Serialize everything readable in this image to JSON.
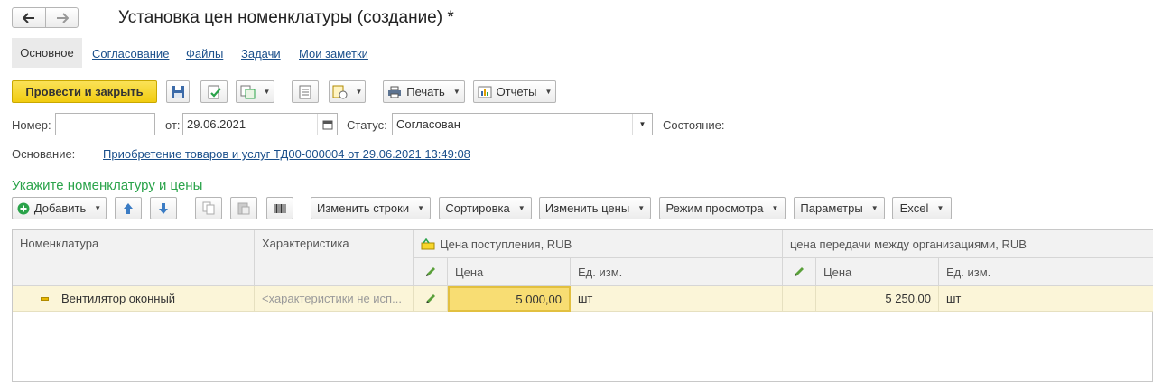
{
  "window": {
    "title": "Установка цен номенклатуры (создание) *"
  },
  "nav": {
    "back_icon": "arrow-left-icon",
    "forward_icon": "arrow-right-icon"
  },
  "tabs": [
    {
      "label": "Основное",
      "active": true
    },
    {
      "label": "Согласование"
    },
    {
      "label": "Файлы"
    },
    {
      "label": "Задачи"
    },
    {
      "label": "Мои заметки"
    }
  ],
  "toolbar": {
    "post_close": "Провести и закрыть",
    "print": "Печать",
    "reports": "Отчеты"
  },
  "form": {
    "number_label": "Номер:",
    "number_value": "",
    "date_label": "от:",
    "date_value": "29.06.2021",
    "status_label": "Статус:",
    "status_value": "Согласован",
    "state_label": "Состояние:",
    "basis_label": "Основание:",
    "basis_link": "Приобретение товаров и услуг ТД00-000004 от 29.06.2021 13:49:08"
  },
  "section": {
    "title": "Укажите номенклатуру и цены"
  },
  "table_toolbar": {
    "add": "Добавить",
    "change_rows": "Изменить строки",
    "sort": "Сортировка",
    "change_prices": "Изменить цены",
    "view_mode": "Режим просмотра",
    "params": "Параметры",
    "excel": "Excel"
  },
  "table": {
    "headers": {
      "item": "Номенклатура",
      "characteristic": "Характеристика",
      "group1": "Цена поступления, RUB",
      "group2": "цена передачи между организациями, RUB",
      "price": "Цена",
      "unit": "Ед. изм."
    },
    "rows": [
      {
        "item": "Вентилятор оконный",
        "characteristic": "<характеристики не исп...",
        "price1": "5 000,00",
        "unit1": "шт",
        "price2": "5 250,00",
        "unit2": "шт"
      }
    ]
  },
  "colors": {
    "accent_yellow": "#f7d62a",
    "section_green": "#2aa34a",
    "link_blue": "#1a4f8b",
    "row_highlight": "#fbf5d8"
  }
}
